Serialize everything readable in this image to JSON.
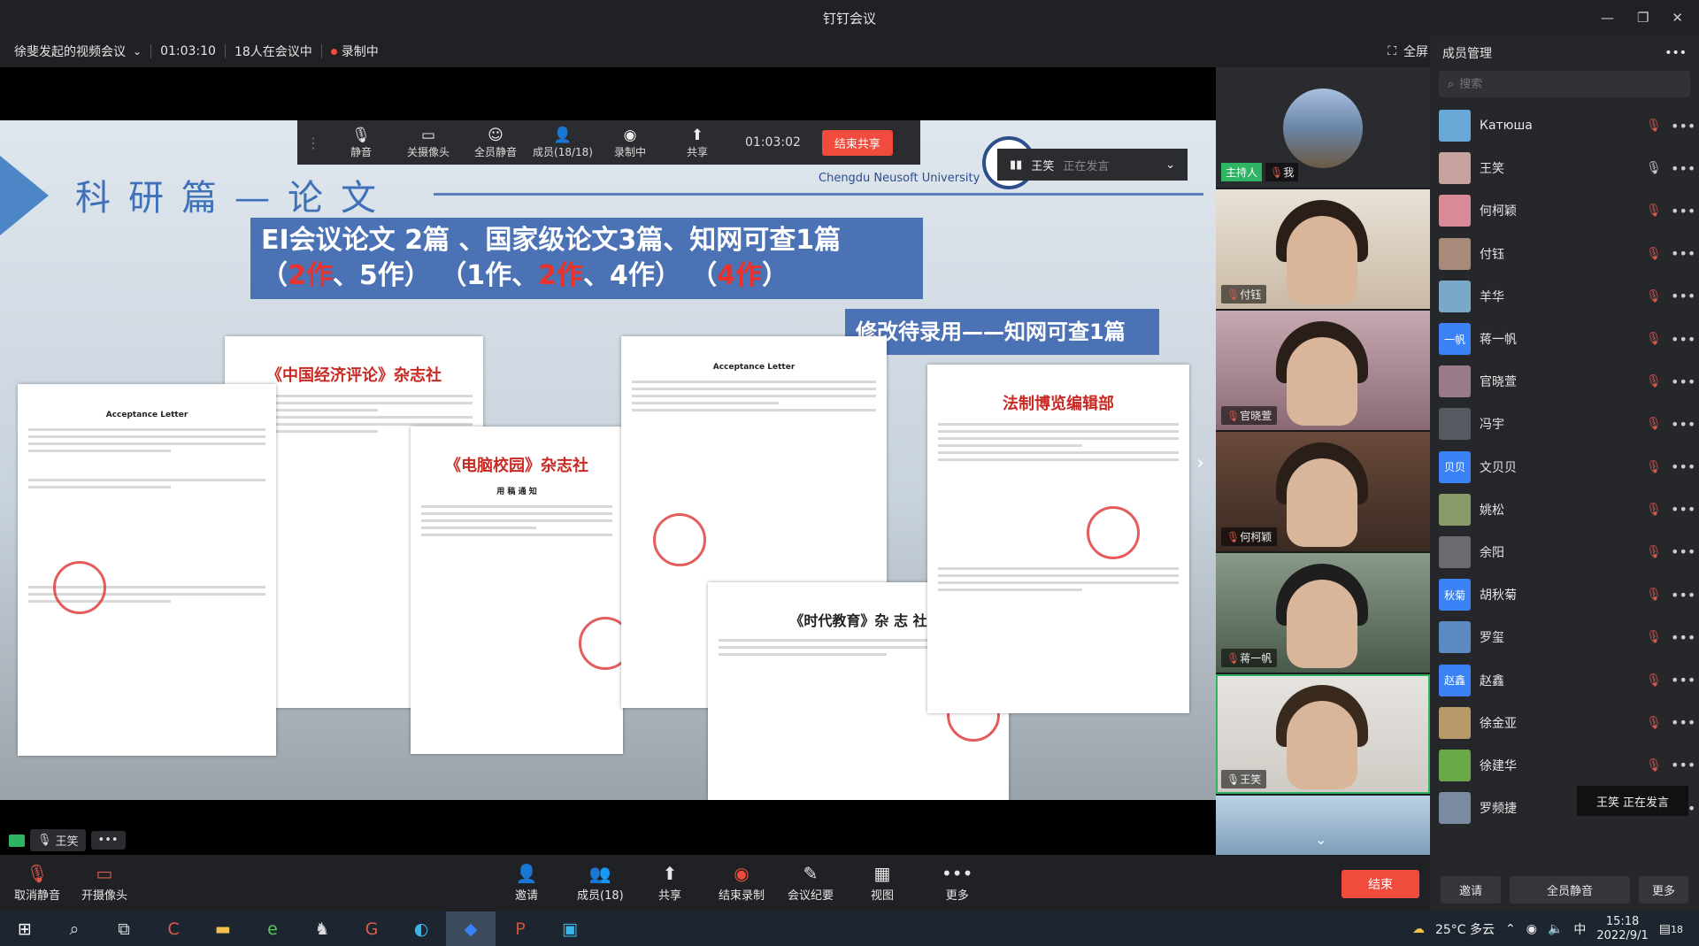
{
  "window": {
    "title": "钉钉会议"
  },
  "info": {
    "meeting_name": "徐斐发起的视频会议",
    "elapsed": "01:03:10",
    "attendees": "18人在会议中",
    "recording": "录制中",
    "fullscreen": "全屏"
  },
  "float_toolbar": {
    "items": [
      {
        "label": "静音",
        "icon": "microphone-icon"
      },
      {
        "label": "关摄像头",
        "icon": "camera-icon"
      },
      {
        "label": "全员静音",
        "icon": "mute-all-icon"
      },
      {
        "label": "成员(18/18)",
        "icon": "members-icon"
      },
      {
        "label": "录制中",
        "icon": "record-icon"
      },
      {
        "label": "共享",
        "icon": "share-icon"
      }
    ],
    "time": "01:03:02",
    "end_share": "结束共享"
  },
  "speaker_popup": {
    "name": "王笑",
    "status": "正在发言"
  },
  "slide": {
    "title": "科研篇—论文",
    "banner_line1": "EI会议论文 2篇 、国家级论文3篇、知网可查1篇",
    "banner_line2_parts": [
      "（",
      "2作",
      "、5作）   （1作、",
      "2作",
      "、4作）     （",
      "4作",
      "）"
    ],
    "banner2": "修改待录用——知网可查1篇",
    "university_en": "Chengdu Neusoft University",
    "docs": {
      "acceptance1": "Acceptance Letter",
      "zgjjpl": "《中国经济评论》杂志社",
      "dnxy": "《电脑校园》杂志社",
      "dnxy_sub": "用 稿 通 知",
      "acceptance2": "Acceptance Letter",
      "sdjy": "《时代教育》杂 志 社",
      "fzbl": "法制博览编辑部"
    }
  },
  "stage_footer": {
    "speaker": "王笑"
  },
  "host_tile": {
    "host_tag": "主持人",
    "me_tag": "我"
  },
  "video_tiles": [
    "付钰",
    "官晓萱",
    "何柯颖",
    "蒋一帆",
    "王笑"
  ],
  "members_panel": {
    "title": "成员管理",
    "search_placeholder": "搜索",
    "members": [
      {
        "name": "Катюша",
        "muted": true,
        "color": "#6aa8d8",
        "avatar_text": ""
      },
      {
        "name": "王笑",
        "muted": false,
        "color": "#c7a3a0",
        "avatar_text": ""
      },
      {
        "name": "何柯颖",
        "muted": true,
        "color": "#d88a96",
        "avatar_text": ""
      },
      {
        "name": "付钰",
        "muted": true,
        "color": "#a88a7a",
        "avatar_text": ""
      },
      {
        "name": "羊华",
        "muted": true,
        "color": "#7aa8c8",
        "avatar_text": ""
      },
      {
        "name": "蒋一帆",
        "muted": true,
        "color": "#3b82f6",
        "avatar_text": "一帆"
      },
      {
        "name": "官晓萱",
        "muted": true,
        "color": "#9a7a8a",
        "avatar_text": ""
      },
      {
        "name": "冯宇",
        "muted": true,
        "color": "#555a60",
        "avatar_text": ""
      },
      {
        "name": "文贝贝",
        "muted": true,
        "color": "#3b82f6",
        "avatar_text": "贝贝"
      },
      {
        "name": "姚松",
        "muted": true,
        "color": "#8a9a6a",
        "avatar_text": ""
      },
      {
        "name": "余阳",
        "muted": true,
        "color": "#6a6a70",
        "avatar_text": ""
      },
      {
        "name": "胡秋菊",
        "muted": true,
        "color": "#3b82f6",
        "avatar_text": "秋菊"
      },
      {
        "name": "罗玺",
        "muted": true,
        "color": "#5a8ac0",
        "avatar_text": ""
      },
      {
        "name": "赵鑫",
        "muted": true,
        "color": "#3b82f6",
        "avatar_text": "赵鑫"
      },
      {
        "name": "徐金亚",
        "muted": true,
        "color": "#b89a6a",
        "avatar_text": ""
      },
      {
        "name": "徐建华",
        "muted": true,
        "color": "#6aa84a",
        "avatar_text": ""
      },
      {
        "name": "罗频捷",
        "muted": false,
        "color": "#7a8aa0",
        "avatar_text": ""
      }
    ],
    "toast_name": "王笑",
    "toast_status": "正在发言",
    "invite": "邀请",
    "mute_all": "全员静音",
    "more": "更多"
  },
  "bottom_toolbar": {
    "unmute": "取消静音",
    "camera": "开摄像头",
    "invite": "邀请",
    "members": "成员(18)",
    "share": "共享",
    "stop_record": "结束录制",
    "minutes": "会议纪要",
    "view": "视图",
    "more": "更多",
    "end": "结束"
  },
  "taskbar": {
    "weather": "25°C 多云",
    "time": "15:18",
    "date": "2022/9/1",
    "notification_count": "18"
  },
  "colors": {
    "accent_red": "#f04b3c",
    "host_green": "#2fb463",
    "panel_bg": "#26272b"
  }
}
